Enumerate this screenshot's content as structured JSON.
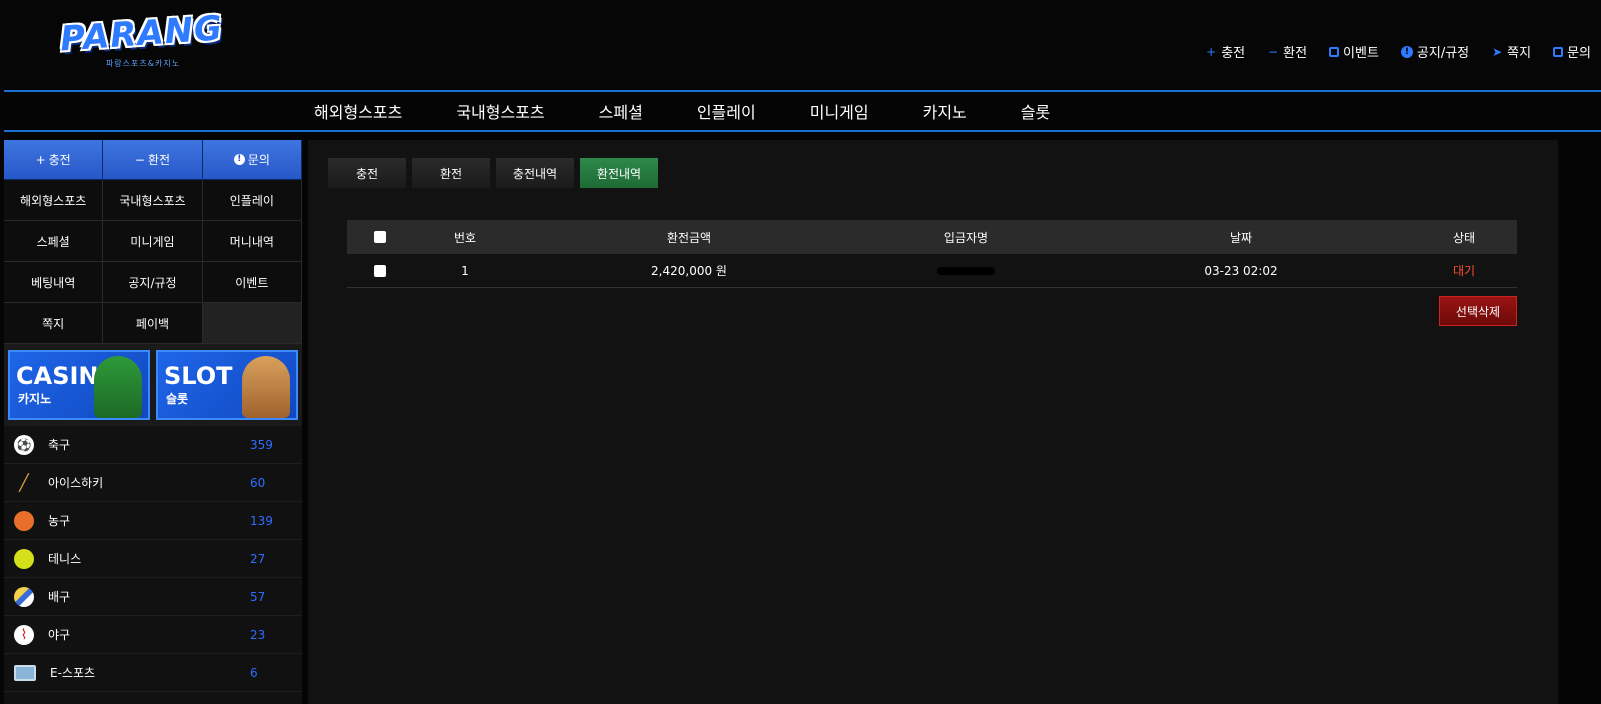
{
  "header": {
    "logo_text": "PARANG",
    "logo_sub": "파랑스포츠&카지노",
    "links": [
      {
        "label": "충전",
        "icon": "plus-icon"
      },
      {
        "label": "환전",
        "icon": "minus-icon"
      },
      {
        "label": "이벤트",
        "icon": "calendar-icon"
      },
      {
        "label": "공지/규정",
        "icon": "notice-icon"
      },
      {
        "label": "쪽지",
        "icon": "paper-plane-icon"
      },
      {
        "label": "문의",
        "icon": "edit-icon"
      }
    ]
  },
  "nav": {
    "items": [
      "해외형스포츠",
      "국내형스포츠",
      "스페셜",
      "인플레이",
      "미니게임",
      "카지노",
      "슬롯"
    ]
  },
  "sidebar": {
    "quick": [
      {
        "label": "충전",
        "icon": "plus-icon"
      },
      {
        "label": "환전",
        "icon": "minus-icon"
      },
      {
        "label": "문의",
        "icon": "info-icon"
      }
    ],
    "menu": [
      "해외형스포츠",
      "국내형스포츠",
      "인플레이",
      "스페셜",
      "미니게임",
      "머니내역",
      "베팅내역",
      "공지/규정",
      "이벤트",
      "쪽지",
      "페이백"
    ],
    "banners": [
      {
        "title": "CASINO",
        "sub": "카지노"
      },
      {
        "title": "SLOT",
        "sub": "슬롯"
      }
    ],
    "sports": [
      {
        "name": "축구",
        "count": "359",
        "icon": "soccer-icon"
      },
      {
        "name": "아이스하키",
        "count": "60",
        "icon": "hockey-icon"
      },
      {
        "name": "농구",
        "count": "139",
        "icon": "basketball-icon"
      },
      {
        "name": "테니스",
        "count": "27",
        "icon": "tennis-icon"
      },
      {
        "name": "배구",
        "count": "57",
        "icon": "volleyball-icon"
      },
      {
        "name": "야구",
        "count": "23",
        "icon": "baseball-icon"
      },
      {
        "name": "E-스포츠",
        "count": "6",
        "icon": "esports-icon"
      }
    ]
  },
  "main": {
    "tabs": [
      {
        "label": "충전",
        "active": false
      },
      {
        "label": "환전",
        "active": false
      },
      {
        "label": "충전내역",
        "active": false
      },
      {
        "label": "환전내역",
        "active": true
      }
    ],
    "table": {
      "headers": {
        "no": "번호",
        "amount": "환전금액",
        "depositor": "입금자명",
        "date": "날짜",
        "status": "상태"
      },
      "rows": [
        {
          "no": "1",
          "amount": "2,420,000 원",
          "depositor": "",
          "date": "03-23 02:02",
          "status": "대기"
        }
      ]
    },
    "delete_label": "선택삭제"
  },
  "colors": {
    "accent": "#2f7bff",
    "active_tab": "#2d8a4a",
    "danger": "#9a1212",
    "status_wait": "#ff4f2f",
    "count": "#2f6dff"
  }
}
